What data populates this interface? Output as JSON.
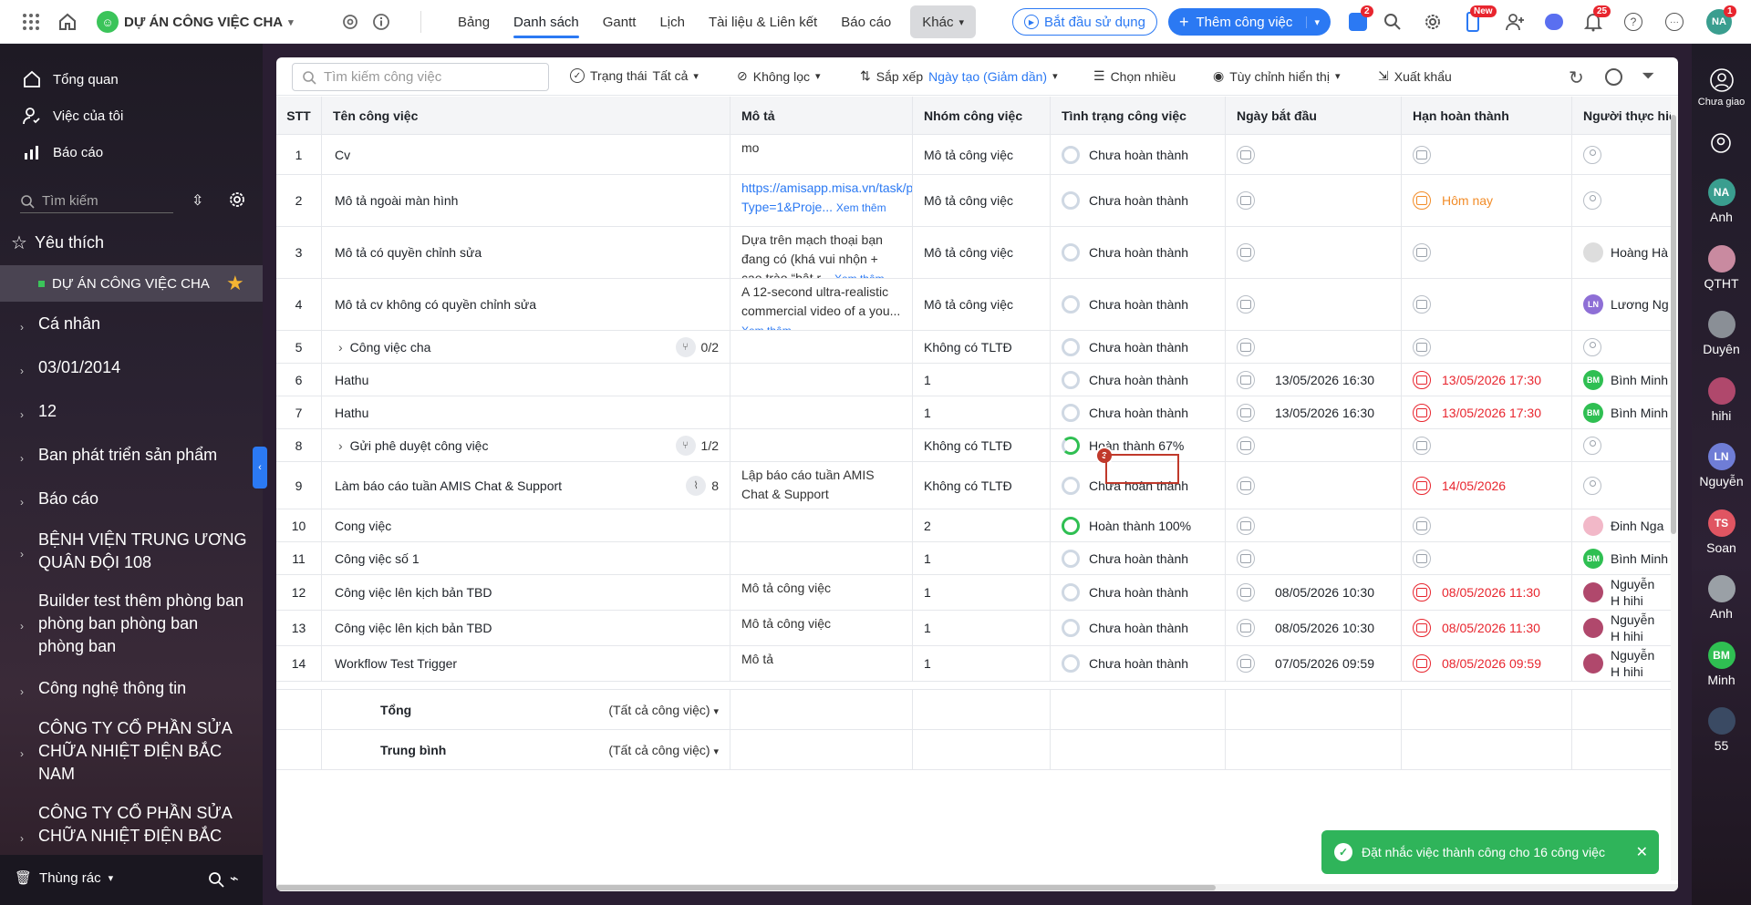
{
  "topbar": {
    "project_name": "DỰ ÁN CÔNG VIỆC CHA",
    "tabs": [
      "Bảng",
      "Danh sách",
      "Gantt",
      "Lịch",
      "Tài liệu & Liên kết",
      "Báo cáo"
    ],
    "more_label": "Khác",
    "start_label": "Bắt đầu sử dụng",
    "add_task_label": "Thêm công việc",
    "badge_cart": "2",
    "badge_new": "New",
    "badge_notif": "25",
    "badge_avatar": "1",
    "avatar_initials": "NA"
  },
  "sidebar": {
    "overview": "Tổng quan",
    "my_tasks": "Việc của tôi",
    "reports": "Báo cáo",
    "search_placeholder": "Tìm kiếm",
    "favorites": "Yêu thích",
    "fav_project": "DỰ ÁN CÔNG VIỆC CHA",
    "groups": [
      "Cá nhân",
      "03/01/2014",
      "12",
      "Ban phát triển sản phẩm",
      "Báo cáo",
      "BỆNH VIỆN TRUNG ƯƠNG QUÂN ĐỘI 108",
      "Builder test thêm phòng ban phòng ban phòng ban phòng ban",
      "Công nghệ thông tin",
      "CÔNG TY CỔ PHẦN SỬA CHỮA NHIỆT ĐIỆN BẮC NAM",
      "CÔNG TY CỔ PHẦN SỬA CHỮA NHIỆT ĐIỆN BẮC"
    ],
    "trash": "Thùng rác"
  },
  "toolbar": {
    "search_placeholder": "Tìm kiếm công việc",
    "status_label": "Trạng thái",
    "status_value": "Tất cả",
    "filter_label": "Không lọc",
    "sort_label": "Sắp xếp",
    "sort_value": "Ngày tạo (Giảm dần)",
    "multi_select": "Chọn nhiều",
    "customize": "Tùy chỉnh hiển thị",
    "export": "Xuất khẩu"
  },
  "table": {
    "headers": [
      "STT",
      "Tên công việc",
      "Mô tả",
      "Nhóm công việc",
      "Tình trạng công việc",
      "Ngày bắt đầu",
      "Hạn hoàn thành",
      "Người thực hiện"
    ],
    "rows": [
      {
        "n": "1",
        "name": "Cv",
        "desc": "mo",
        "group": "Mô tả công việc",
        "status": "Chưa hoàn thành",
        "start": "",
        "due": "",
        "assignee": ""
      },
      {
        "n": "2",
        "name": "Mô tả ngoài màn hình",
        "desc": "https://amisapp.misa.vn/task/project?Type=1&Proje...",
        "group": "Mô tả công việc",
        "status": "Chưa hoàn thành",
        "start": "",
        "due": "Hôm nay",
        "assignee": ""
      },
      {
        "n": "3",
        "name": "Mô tả có quyền chỉnh sửa",
        "desc": "Dựa trên mạch thoại bạn đang có (khá vui nhộn + cao trào “bật r...",
        "group": "Mô tả công việc",
        "status": "Chưa hoàn thành",
        "start": "",
        "due": "",
        "assignee": "Hoàng Hà"
      },
      {
        "n": "4",
        "name": "Mô tả cv không có quyền chỉnh sửa",
        "desc": "A 12-second ultra-realistic commercial video of a you...",
        "group": "Mô tả công việc",
        "status": "Chưa hoàn thành",
        "start": "",
        "due": "",
        "assignee": "Lương Ng"
      },
      {
        "n": "5",
        "name": "Công việc cha",
        "desc": "",
        "group": "Không có TLTĐ",
        "status": "Chưa hoàn thành",
        "start": "",
        "due": "",
        "assignee": "",
        "sub": "0/2"
      },
      {
        "n": "6",
        "name": "Hathu",
        "desc": "",
        "group": "1",
        "status": "Chưa hoàn thành",
        "start": "13/05/2026 16:30",
        "due": "13/05/2026 17:30",
        "assignee": "Bình Minh"
      },
      {
        "n": "7",
        "name": "Hathu",
        "desc": "",
        "group": "1",
        "status": "Chưa hoàn thành",
        "start": "13/05/2026 16:30",
        "due": "13/05/2026 17:30",
        "assignee": "Bình Minh"
      },
      {
        "n": "8",
        "name": "Gửi phê duyệt công việc",
        "desc": "",
        "group": "Không có TLTĐ",
        "status": "Hoàn thành 67%",
        "start": "",
        "due": "",
        "assignee": "",
        "sub": "1/2"
      },
      {
        "n": "9",
        "name": "Làm báo cáo tuần AMIS Chat & Support",
        "desc": "Lập báo cáo tuần AMIS Chat & Support",
        "group": "Không có TLTĐ",
        "status": "Chưa hoàn thành",
        "start": "",
        "due": "14/05/2026",
        "assignee": "",
        "attach": "8"
      },
      {
        "n": "10",
        "name": "Cong việc",
        "desc": "",
        "group": "2",
        "status": "Hoàn thành 100%",
        "start": "",
        "due": "",
        "assignee": "Đinh Nga"
      },
      {
        "n": "11",
        "name": "Công việc số 1",
        "desc": "",
        "group": "1",
        "status": "Chưa hoàn thành",
        "start": "",
        "due": "",
        "assignee": "Bình Minh"
      },
      {
        "n": "12",
        "name": "Công việc lên kịch bản TBD",
        "desc": "Mô tả công việc",
        "group": "1",
        "status": "Chưa hoàn thành",
        "start": "08/05/2026 10:30",
        "due": "08/05/2026 11:30",
        "assignee": "Nguyễn H hihi"
      },
      {
        "n": "13",
        "name": "Công việc lên kịch bản TBD",
        "desc": "Mô tả công việc",
        "group": "1",
        "status": "Chưa hoàn thành",
        "start": "08/05/2026 10:30",
        "due": "08/05/2026 11:30",
        "assignee": "Nguyễn H hihi"
      },
      {
        "n": "14",
        "name": "Workflow Test Trigger",
        "desc": "Mô tả",
        "group": "1",
        "status": "Chưa hoàn thành",
        "start": "07/05/2026 09:59",
        "due": "08/05/2026 09:59",
        "assignee": "Nguyễn H hihi"
      }
    ],
    "xem_them": "Xem thêm",
    "footer_total": "Tổng",
    "footer_avg": "Trung bình",
    "footer_scope": "(Tất cả công việc)",
    "step_badge": "3"
  },
  "rightrail": {
    "unassigned": "Chưa giao",
    "people": [
      {
        "initials": "NA",
        "name": "Anh",
        "color": "#3a9e8f"
      },
      {
        "initials": "",
        "name": "QTHT",
        "color": "#c98aa0"
      },
      {
        "initials": "",
        "name": "Duyên",
        "color": "#8a8f96"
      },
      {
        "initials": "",
        "name": "hihi",
        "color": "#b0486c"
      },
      {
        "initials": "LN",
        "name": "Nguyễn",
        "color": "#6f7dd6"
      },
      {
        "initials": "TS",
        "name": "Soan",
        "color": "#e05562"
      },
      {
        "initials": "",
        "name": "Anh",
        "color": "#9aa0a6"
      },
      {
        "initials": "BM",
        "name": "Minh",
        "color": "#2fbf52"
      },
      {
        "initials": "",
        "name": "55",
        "color": "#3a4a63"
      }
    ]
  },
  "toast": {
    "message": "Đặt nhắc việc thành công cho 16 công việc"
  }
}
